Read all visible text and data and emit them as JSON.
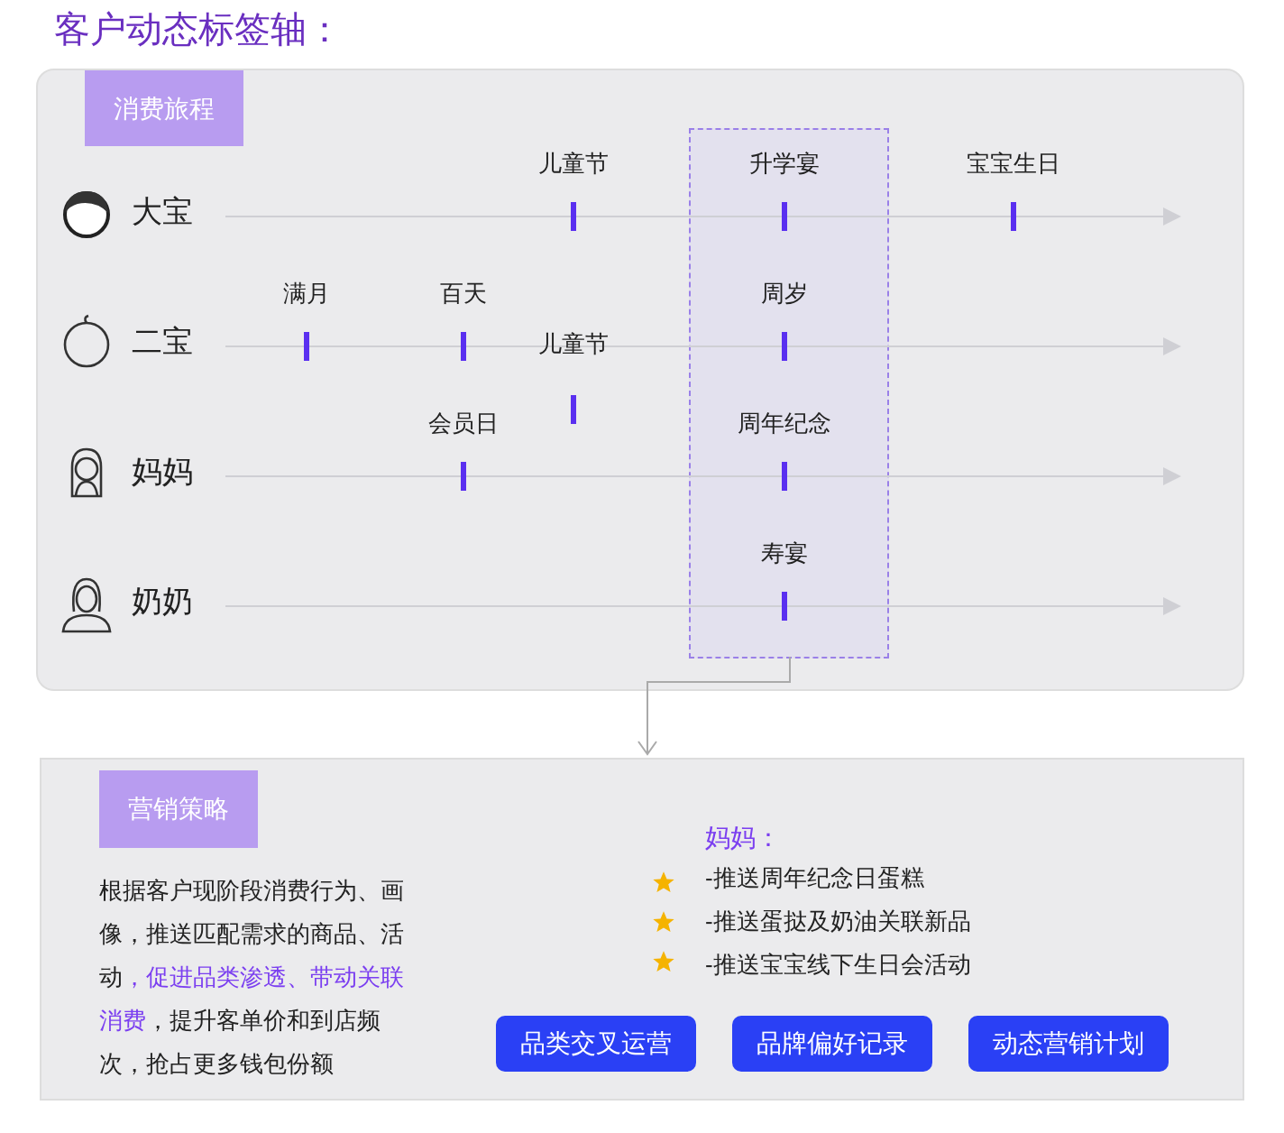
{
  "title": "客户动态标签轴：",
  "journey": {
    "tag": "消费旅程",
    "rows": [
      {
        "name": "大宝",
        "kind": "child",
        "events": [
          {
            "kind": "gap"
          },
          {
            "kind": "gap"
          },
          {
            "label": "儿童节",
            "kind": "above"
          },
          {
            "label": "升学宴",
            "kind": "above"
          },
          {
            "label": "宝宝生日",
            "kind": "above"
          }
        ]
      },
      {
        "name": "二宝",
        "kind": "baby",
        "events": [
          {
            "label": "满月",
            "kind": "above"
          },
          {
            "label": "百天",
            "kind": "above"
          },
          {
            "label": "儿童节",
            "kind": "below"
          },
          {
            "label": "周岁",
            "kind": "above"
          },
          {
            "kind": "gap"
          }
        ]
      },
      {
        "name": "妈妈",
        "kind": "mother",
        "events": [
          {
            "kind": "gap"
          },
          {
            "label": "会员日",
            "kind": "above"
          },
          {
            "kind": "gap"
          },
          {
            "label": "周年纪念",
            "kind": "above"
          },
          {
            "kind": "gap"
          }
        ]
      },
      {
        "name": "奶奶",
        "kind": "elder",
        "events": [
          {
            "kind": "gap"
          },
          {
            "kind": "gap"
          },
          {
            "kind": "gap"
          },
          {
            "label": "寿宴",
            "kind": "above"
          },
          {
            "kind": "gap"
          }
        ]
      }
    ]
  },
  "strategy": {
    "tag": "营销策略",
    "paragraph": [
      {
        "text": "根据客户现阶段消费行为、画像，推送匹配需求的商品、活动",
        "highlight": false
      },
      {
        "text": "，促进品类渗透、带动关联消费",
        "highlight": true
      },
      {
        "text": "，提升客单价和到店频次，抢占更多钱包份额",
        "highlight": false
      }
    ],
    "target": "妈妈：",
    "items": [
      "-推送周年纪念日蛋糕",
      "-推送蛋挞及奶油关联新品",
      "-推送宝宝线下生日会活动"
    ],
    "buttons": [
      "品类交叉运营",
      "品牌偏好记录",
      "动态营销计划"
    ]
  }
}
